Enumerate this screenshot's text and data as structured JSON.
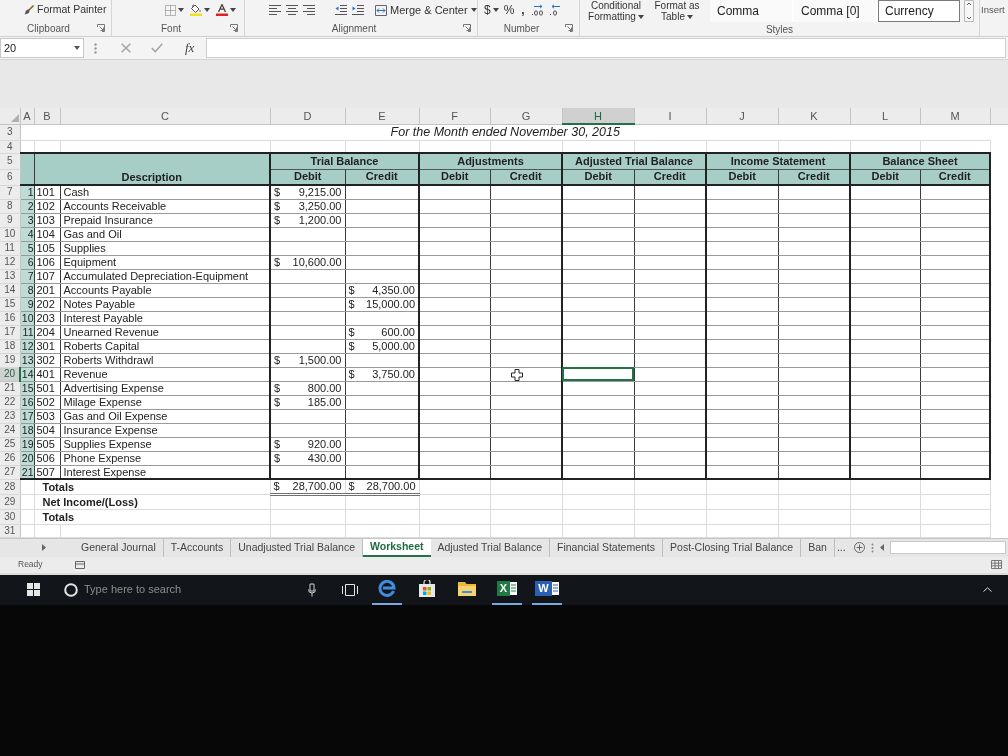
{
  "ribbon": {
    "clipboard": {
      "format_painter": "Format Painter",
      "label": "Clipboard"
    },
    "font": {
      "label": "Font"
    },
    "alignment": {
      "merge_button": "Merge & Center",
      "label": "Alignment"
    },
    "number": {
      "currency": "$",
      "percent": "%",
      "comma": ",",
      "label": "Number"
    },
    "styles": {
      "conditional_formatting": "Conditional Formatting",
      "format_as_table": "Format as Table",
      "gallery": [
        {
          "label": "Comma",
          "selected": false
        },
        {
          "label": "Comma [0]",
          "selected": false
        },
        {
          "label": "Currency",
          "selected": true
        }
      ],
      "label": "Styles"
    },
    "cells": {
      "insert": "Insert"
    }
  },
  "formula_bar": {
    "name_box": "20",
    "function_button": "fx"
  },
  "sheet": {
    "columns": [
      {
        "label": "A",
        "selected": false
      },
      {
        "label": "B",
        "selected": false
      },
      {
        "label": "C",
        "selected": false
      },
      {
        "label": "D",
        "selected": false
      },
      {
        "label": "E",
        "selected": false
      },
      {
        "label": "F",
        "selected": false
      },
      {
        "label": "G",
        "selected": false
      },
      {
        "label": "H",
        "selected": true
      },
      {
        "label": "I",
        "selected": false
      },
      {
        "label": "J",
        "selected": false
      },
      {
        "label": "K",
        "selected": false
      },
      {
        "label": "L",
        "selected": false
      },
      {
        "label": "M",
        "selected": false
      }
    ],
    "rows": [
      {
        "kind": "title",
        "number": "3",
        "selected": false,
        "text": "For the Month ended November 30, 2015"
      },
      {
        "kind": "blank",
        "number": "4",
        "selected": false
      },
      {
        "kind": "header",
        "number": "5",
        "selected": false,
        "description": "Description",
        "sections": [
          "Trial Balance",
          "Adjustments",
          "Adjusted Trial Balance",
          "Income Statement",
          "Balance Sheet"
        ]
      },
      {
        "kind": "subheader",
        "number": "6",
        "selected": false,
        "labels": [
          "Debit",
          "Credit",
          "Debit",
          "Credit",
          "Debit",
          "Credit",
          "Debit",
          "Credit",
          "Debit",
          "Credit"
        ]
      },
      {
        "kind": "account",
        "number": "7",
        "selected": false,
        "index": "1",
        "account": "101",
        "description": "Cash",
        "debit": {
          "symbol": "$",
          "amount": "9,215.00"
        }
      },
      {
        "kind": "account",
        "number": "8",
        "selected": false,
        "index": "2",
        "account": "102",
        "description": "Accounts Receivable",
        "debit": {
          "symbol": "$",
          "amount": "3,250.00"
        }
      },
      {
        "kind": "account",
        "number": "9",
        "selected": false,
        "index": "3",
        "account": "103",
        "description": "Prepaid Insurance",
        "debit": {
          "symbol": "$",
          "amount": "1,200.00"
        }
      },
      {
        "kind": "account",
        "number": "10",
        "selected": false,
        "index": "4",
        "account": "104",
        "description": "Gas and Oil"
      },
      {
        "kind": "account",
        "number": "11",
        "selected": false,
        "index": "5",
        "account": "105",
        "description": "Supplies"
      },
      {
        "kind": "account",
        "number": "12",
        "selected": false,
        "index": "6",
        "account": "106",
        "description": "Equipment",
        "debit": {
          "symbol": "$",
          "amount": "10,600.00"
        }
      },
      {
        "kind": "account",
        "number": "13",
        "selected": false,
        "index": "7",
        "account": "107",
        "description": "Accumulated Depreciation-Equipment"
      },
      {
        "kind": "account",
        "number": "14",
        "selected": false,
        "index": "8",
        "account": "201",
        "description": "Accounts Payable",
        "credit": {
          "symbol": "$",
          "amount": "4,350.00"
        }
      },
      {
        "kind": "account",
        "number": "15",
        "selected": false,
        "index": "9",
        "account": "202",
        "description": "Notes Payable",
        "credit": {
          "symbol": "$",
          "amount": "15,000.00"
        }
      },
      {
        "kind": "account",
        "number": "16",
        "selected": false,
        "index": "10",
        "account": "203",
        "description": "Interest Payable"
      },
      {
        "kind": "account",
        "number": "17",
        "selected": false,
        "index": "11",
        "account": "204",
        "description": "Unearned Revenue",
        "credit": {
          "symbol": "$",
          "amount": "600.00"
        }
      },
      {
        "kind": "account",
        "number": "18",
        "selected": false,
        "index": "12",
        "account": "301",
        "description": "Roberts Capital",
        "credit": {
          "symbol": "$",
          "amount": "5,000.00"
        }
      },
      {
        "kind": "account",
        "number": "19",
        "selected": false,
        "index": "13",
        "account": "302",
        "description": "Roberts Withdrawl",
        "debit": {
          "symbol": "$",
          "amount": "1,500.00"
        }
      },
      {
        "kind": "account",
        "number": "20",
        "selected": true,
        "index": "14",
        "account": "401",
        "description": "Revenue",
        "credit": {
          "symbol": "$",
          "amount": "3,750.00"
        }
      },
      {
        "kind": "account",
        "number": "21",
        "selected": false,
        "index": "15",
        "account": "501",
        "description": "Advertising Expense",
        "debit": {
          "symbol": "$",
          "amount": "800.00"
        }
      },
      {
        "kind": "account",
        "number": "22",
        "selected": false,
        "index": "16",
        "account": "502",
        "description": "Milage Expense",
        "debit": {
          "symbol": "$",
          "amount": "185.00"
        }
      },
      {
        "kind": "account",
        "number": "23",
        "selected": false,
        "index": "17",
        "account": "503",
        "description": "Gas and Oil Expense"
      },
      {
        "kind": "account",
        "number": "24",
        "selected": false,
        "index": "18",
        "account": "504",
        "description": "Insurance Expense"
      },
      {
        "kind": "account",
        "number": "25",
        "selected": false,
        "index": "19",
        "account": "505",
        "description": "Supplies Expense",
        "debit": {
          "symbol": "$",
          "amount": "920.00"
        }
      },
      {
        "kind": "account",
        "number": "26",
        "selected": false,
        "index": "20",
        "account": "506",
        "description": "Phone Expense",
        "debit": {
          "symbol": "$",
          "amount": "430.00"
        }
      },
      {
        "kind": "account",
        "number": "27",
        "selected": false,
        "index": "21",
        "account": "507",
        "description": "Interest Expense"
      },
      {
        "kind": "total",
        "number": "28",
        "selected": false,
        "label": "Totals",
        "double_rule": true,
        "debit": {
          "symbol": "$",
          "amount": "28,700.00"
        },
        "credit": {
          "symbol": "$",
          "amount": "28,700.00"
        }
      },
      {
        "kind": "total",
        "number": "29",
        "selected": false,
        "label": "Net Income/(Loss)",
        "double_rule": false
      },
      {
        "kind": "total",
        "number": "30",
        "selected": false,
        "label": "Totals",
        "double_rule": false
      },
      {
        "kind": "blank",
        "number": "31",
        "selected": false
      }
    ]
  },
  "sheet_tabs": {
    "tabs": [
      {
        "label": "General Journal",
        "selected": false
      },
      {
        "label": "T-Accounts",
        "selected": false
      },
      {
        "label": "Unadjusted Trial Balance",
        "selected": false
      },
      {
        "label": "Worksheet",
        "selected": true
      },
      {
        "label": "Adjusted Trial Balance",
        "selected": false
      },
      {
        "label": "Financial Statements",
        "selected": false
      },
      {
        "label": "Post-Closing Trial Balance",
        "selected": false
      },
      {
        "label": "Ban",
        "selected": false
      }
    ],
    "overflow": "..."
  },
  "status_bar": {
    "status": "Ready"
  },
  "taskbar": {
    "search": {
      "placeholder": "Type here to search"
    },
    "apps": [
      {
        "kind": "browser",
        "running": true
      },
      {
        "kind": "store",
        "running": false
      },
      {
        "kind": "folder",
        "running": false
      },
      {
        "kind": "spreadsheet",
        "letter": "X",
        "running": true
      },
      {
        "kind": "document",
        "letter": "W",
        "running": true
      }
    ]
  }
}
